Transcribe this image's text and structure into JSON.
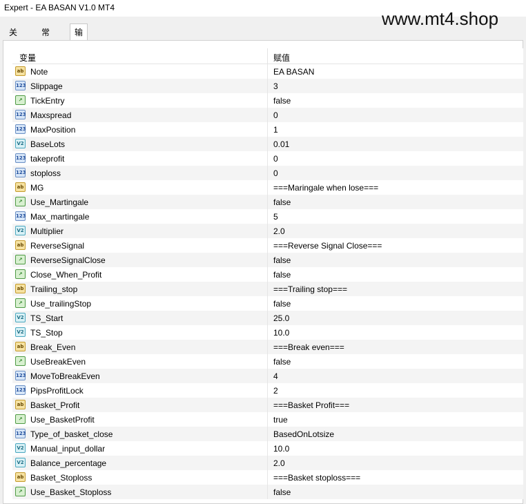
{
  "window": {
    "title": "Expert - EA BASAN V1.0 MT4"
  },
  "watermark": "www.mt4.shop",
  "tabs": [
    {
      "label": "关于"
    },
    {
      "label": "常用"
    },
    {
      "label": "输入参数",
      "active": true
    }
  ],
  "table": {
    "headers": {
      "variable": "变量",
      "value": "赋值"
    },
    "icon_labels": {
      "string": "ab",
      "int": "123",
      "bool": "↗",
      "double": "V2"
    },
    "rows": [
      {
        "type": "string",
        "name": "Note",
        "value": "EA BASAN"
      },
      {
        "type": "int",
        "name": "Slippage",
        "value": "3"
      },
      {
        "type": "bool",
        "name": "TickEntry",
        "value": "false"
      },
      {
        "type": "int",
        "name": "Maxspread",
        "value": "0"
      },
      {
        "type": "int",
        "name": "MaxPosition",
        "value": "1"
      },
      {
        "type": "double",
        "name": "BaseLots",
        "value": "0.01"
      },
      {
        "type": "int",
        "name": "takeprofit",
        "value": "0"
      },
      {
        "type": "int",
        "name": "stoploss",
        "value": "0"
      },
      {
        "type": "string",
        "name": "MG",
        "value": "===Maringale when lose==="
      },
      {
        "type": "bool",
        "name": "Use_Martingale",
        "value": "false"
      },
      {
        "type": "int",
        "name": "Max_martingale",
        "value": "5"
      },
      {
        "type": "double",
        "name": "Multiplier",
        "value": "2.0"
      },
      {
        "type": "string",
        "name": "ReverseSignal",
        "value": "===Reverse Signal Close==="
      },
      {
        "type": "bool",
        "name": "ReverseSignalClose",
        "value": "false"
      },
      {
        "type": "bool",
        "name": "Close_When_Profit",
        "value": "false"
      },
      {
        "type": "string",
        "name": "Trailing_stop",
        "value": "===Trailing stop==="
      },
      {
        "type": "bool",
        "name": "Use_trailingStop",
        "value": "false"
      },
      {
        "type": "double",
        "name": "TS_Start",
        "value": "25.0"
      },
      {
        "type": "double",
        "name": "TS_Stop",
        "value": "10.0"
      },
      {
        "type": "string",
        "name": "Break_Even",
        "value": "===Break even==="
      },
      {
        "type": "bool",
        "name": "UseBreakEven",
        "value": "false"
      },
      {
        "type": "int",
        "name": "MoveToBreakEven",
        "value": "4"
      },
      {
        "type": "int",
        "name": "PipsProfitLock",
        "value": "2"
      },
      {
        "type": "string",
        "name": "Basket_Profit",
        "value": "===Basket Profit==="
      },
      {
        "type": "bool",
        "name": "Use_BasketProfit",
        "value": "true"
      },
      {
        "type": "int",
        "name": "Type_of_basket_close",
        "value": "BasedOnLotsize"
      },
      {
        "type": "double",
        "name": "Manual_input_dollar",
        "value": "10.0"
      },
      {
        "type": "double",
        "name": "Balance_percentage",
        "value": "2.0"
      },
      {
        "type": "string",
        "name": "Basket_Stoploss",
        "value": "===Basket stoploss==="
      },
      {
        "type": "bool",
        "name": "Use_Basket_Stoploss",
        "value": "false"
      }
    ]
  }
}
